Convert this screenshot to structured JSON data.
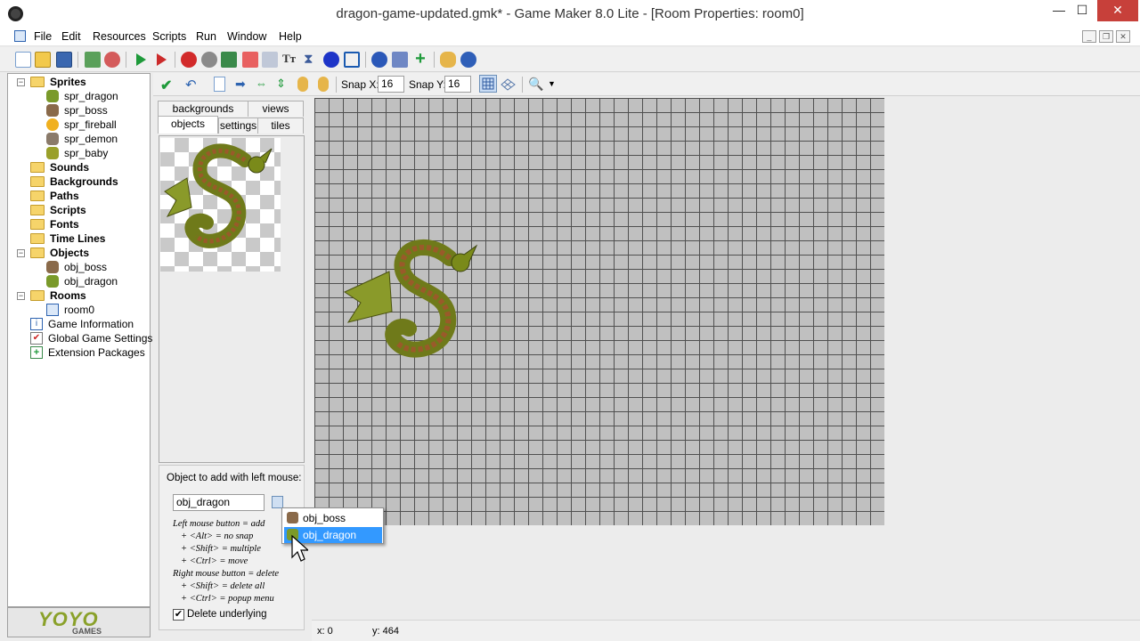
{
  "window": {
    "title": "dragon-game-updated.gmk* - Game Maker 8.0 Lite - [Room Properties: room0]",
    "controls": {
      "minimize": "—",
      "maximize": "☐",
      "close": "✕"
    }
  },
  "menu": [
    "File",
    "Edit",
    "Resources",
    "Scripts",
    "Run",
    "Window",
    "Help"
  ],
  "mdi_controls": [
    "_",
    "❐",
    "✕"
  ],
  "tree": {
    "sprites": {
      "label": "Sprites",
      "items": [
        "spr_dragon",
        "spr_boss",
        "spr_fireball",
        "spr_demon",
        "spr_baby"
      ]
    },
    "sounds": "Sounds",
    "backgrounds": "Backgrounds",
    "paths": "Paths",
    "scripts": "Scripts",
    "fonts": "Fonts",
    "timelines": "Time Lines",
    "objects": {
      "label": "Objects",
      "items": [
        "obj_boss",
        "obj_dragon"
      ]
    },
    "rooms": {
      "label": "Rooms",
      "items": [
        "room0"
      ]
    },
    "game_information": "Game Information",
    "global_settings": "Global Game Settings",
    "extension_packages": "Extension Packages"
  },
  "logo": {
    "text": "YOYO",
    "sub": "GAMES"
  },
  "room_toolbar": {
    "snap_x_label": "Snap X:",
    "snap_x": "16",
    "snap_y_label": "Snap Y:",
    "snap_y": "16"
  },
  "tabs": {
    "backgrounds": "backgrounds",
    "views": "views",
    "objects": "objects",
    "settings": "settings",
    "tiles": "tiles"
  },
  "add_panel": {
    "heading": "Object to add with left mouse:",
    "selected_object": "obj_dragon",
    "help_lines": [
      "Left mouse button = add",
      "+ <Alt> = no snap",
      "+ <Shift> = multiple",
      "+ <Ctrl> = move",
      "Right mouse button = delete",
      "+ <Shift> = delete all",
      "+ <Ctrl> = popup menu"
    ],
    "delete_underlying_label": "Delete underlying",
    "delete_underlying_checked": "✔"
  },
  "dropdown": {
    "items": [
      "obj_boss",
      "obj_dragon"
    ],
    "selected": "obj_dragon"
  },
  "status": {
    "x": "x: 0",
    "y": "y: 464"
  },
  "colors": {
    "accent": "#3399ff",
    "close": "#c7403a",
    "folder": "#f6d46a",
    "grid": "#c0c0c0"
  }
}
